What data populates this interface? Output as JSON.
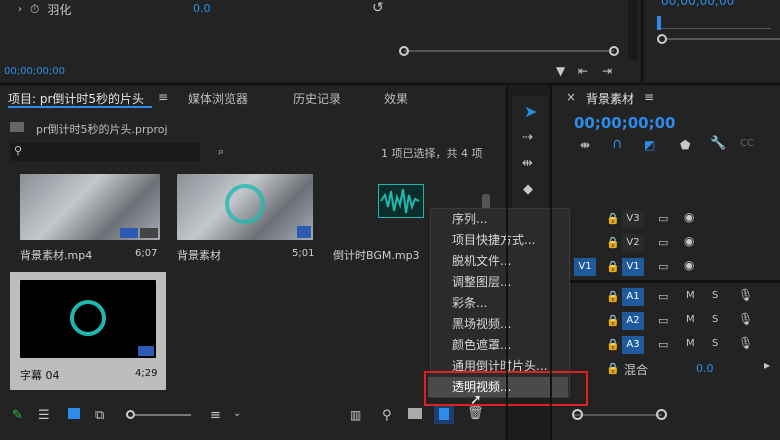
{
  "effect_controls": {
    "param_label": "羽化",
    "param_value": "0.0",
    "timecode": "00;00;00;00"
  },
  "project_panel": {
    "tabs": [
      {
        "label": "项目: pr倒计时5秒的片头"
      },
      {
        "label": "媒体浏览器"
      },
      {
        "label": "历史记录"
      },
      {
        "label": "效果"
      }
    ],
    "file_name": "pr倒计时5秒的片头.prproj",
    "search_placeholder": "",
    "selection_status": "1 项已选择，共 4 项",
    "items": [
      {
        "name": "背景素材.mp4",
        "duration": "6;07"
      },
      {
        "name": "背景素材",
        "duration": "5;01"
      },
      {
        "name": "倒计时BGM.mp3",
        "duration": ""
      },
      {
        "name": "字幕 04",
        "duration": "4;29"
      }
    ]
  },
  "context_menu": {
    "items": [
      {
        "label": "序列..."
      },
      {
        "label": "项目快捷方式..."
      },
      {
        "label": "脱机文件..."
      },
      {
        "label": "调整图层..."
      },
      {
        "label": "彩条..."
      },
      {
        "label": "黑场视频..."
      },
      {
        "label": "颜色遮罩..."
      },
      {
        "label": "通用倒计时片头..."
      },
      {
        "label": "透明视频..."
      }
    ],
    "highlighted_index": 8
  },
  "timeline": {
    "title": "背景素材",
    "timecode": "00;00;00;00",
    "top_timecode": "00;00;00;00",
    "video_tracks": [
      "V3",
      "V2",
      "V1"
    ],
    "audio_tracks": [
      "A1",
      "A2",
      "A3"
    ],
    "source_patch": "V1",
    "mix_label": "混合",
    "mix_value": "0.0",
    "mute_label": "M",
    "solo_label": "S"
  },
  "colors": {
    "accent": "#2d8ceb",
    "highlight_border": "#e02020",
    "teal": "#1fb8b0"
  }
}
